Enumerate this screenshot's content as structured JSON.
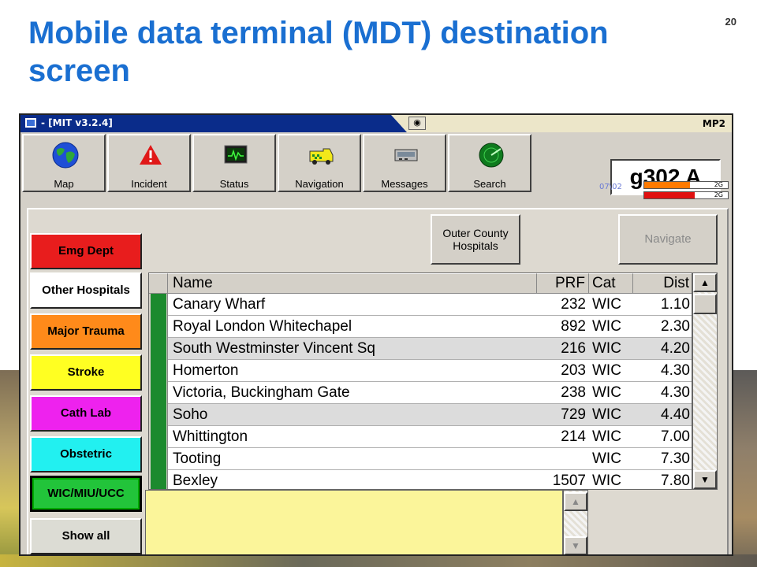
{
  "slide": {
    "title": "Mobile data terminal (MDT) destination screen",
    "page_number": "20"
  },
  "window": {
    "title": "- [MIT v3.2.4]",
    "right_label": "MP2"
  },
  "toolbar": [
    {
      "label": "Map",
      "icon": "globe-icon"
    },
    {
      "label": "Incident",
      "icon": "warning-icon"
    },
    {
      "label": "Status",
      "icon": "monitor-icon"
    },
    {
      "label": "Navigation",
      "icon": "ambulance-icon"
    },
    {
      "label": "Messages",
      "icon": "message-device-icon"
    },
    {
      "label": "Search",
      "icon": "radar-icon"
    }
  ],
  "status": {
    "callsign": "g302 A",
    "date": "07\\02",
    "signal1": {
      "label": "2G",
      "fill": 0.55,
      "color": "#ff7a00"
    },
    "signal2": {
      "label": "2G",
      "fill": 0.6,
      "color": "#e01010"
    }
  },
  "categories": [
    {
      "label": "Emg Dept",
      "color": "#e81d1d"
    },
    {
      "label": "Other Hospitals",
      "color": "#ffffff"
    },
    {
      "label": "Major Trauma",
      "color": "#ff8a1a"
    },
    {
      "label": "Stroke",
      "color": "#ffff22"
    },
    {
      "label": "Cath Lab",
      "color": "#ee22ee"
    },
    {
      "label": "Obstetric",
      "color": "#22f0f0"
    },
    {
      "label": "WIC/MIU/UCC",
      "color": "#22c43a",
      "selected": true
    },
    {
      "label": "Show all",
      "color": "#dcdcd4"
    }
  ],
  "buttons": {
    "outer_county": "Outer County Hospitals",
    "navigate": "Navigate"
  },
  "table": {
    "columns": [
      "Name",
      "PRF",
      "Cat",
      "Dist"
    ],
    "rows": [
      {
        "name": "Canary Wharf",
        "prf": "232",
        "cat": "WIC",
        "dist": "1.10"
      },
      {
        "name": "Royal London  Whitechapel",
        "prf": "892",
        "cat": "WIC",
        "dist": "2.30"
      },
      {
        "name": "South Westminster Vincent Sq",
        "prf": "216",
        "cat": "WIC",
        "dist": "4.20"
      },
      {
        "name": "Homerton",
        "prf": "203",
        "cat": "WIC",
        "dist": "4.30"
      },
      {
        "name": "Victoria, Buckingham Gate",
        "prf": "238",
        "cat": "WIC",
        "dist": "4.30"
      },
      {
        "name": "Soho",
        "prf": "729",
        "cat": "WIC",
        "dist": "4.40"
      },
      {
        "name": "Whittington",
        "prf": "214",
        "cat": "WIC",
        "dist": "7.00"
      },
      {
        "name": "Tooting",
        "prf": "",
        "cat": "WIC",
        "dist": "7.30"
      },
      {
        "name": "Bexley",
        "prf": "1507",
        "cat": "WIC",
        "dist": "7.80"
      }
    ]
  },
  "message_area": {
    "text": ""
  }
}
